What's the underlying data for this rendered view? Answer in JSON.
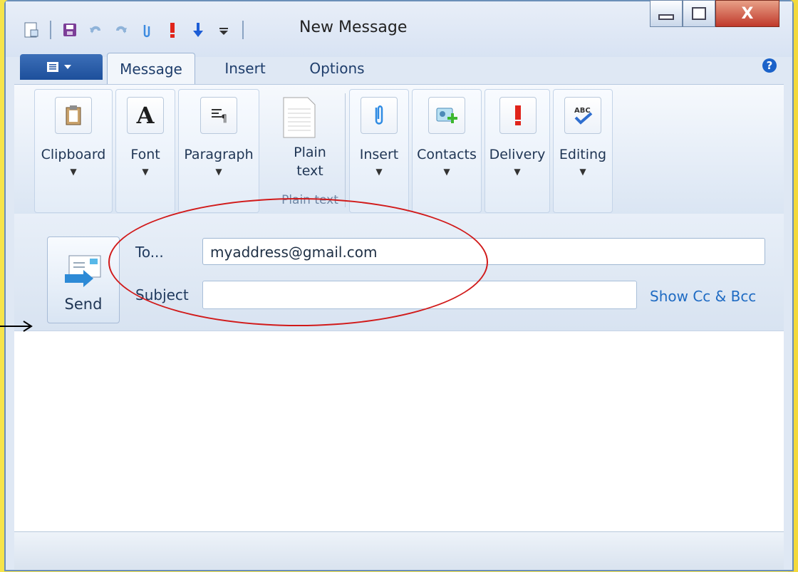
{
  "window": {
    "title": "New Message",
    "colors": {
      "background": "#f6e44a",
      "accent_blue": "#1d4f9b",
      "link_blue": "#1f6bc3",
      "annotation_red": "#d11a1a"
    }
  },
  "quick_access": {
    "icons": [
      "new-doc-icon",
      "save-icon",
      "undo-icon",
      "redo-icon",
      "attach-icon",
      "important-icon",
      "low-priority-icon",
      "customize-icon"
    ]
  },
  "tabs": [
    {
      "label": "Message",
      "active": true
    },
    {
      "label": "Insert",
      "active": false
    },
    {
      "label": "Options",
      "active": false
    }
  ],
  "ribbon": {
    "groups": [
      {
        "label": "Clipboard"
      },
      {
        "label": "Font"
      },
      {
        "label": "Paragraph"
      },
      {
        "label": "Plain text",
        "line1": "Plain",
        "line2": "text"
      },
      {
        "label": "Insert"
      },
      {
        "label": "Contacts"
      },
      {
        "label": "Delivery"
      },
      {
        "label": "Editing"
      }
    ],
    "plain_text_group_label": "Plain text"
  },
  "compose": {
    "send_label": "Send",
    "to_label": "To...",
    "to_value": "myaddress@gmail.com",
    "subject_label": "Subject",
    "subject_value": "",
    "show_cc_bcc": "Show Cc & Bcc"
  }
}
